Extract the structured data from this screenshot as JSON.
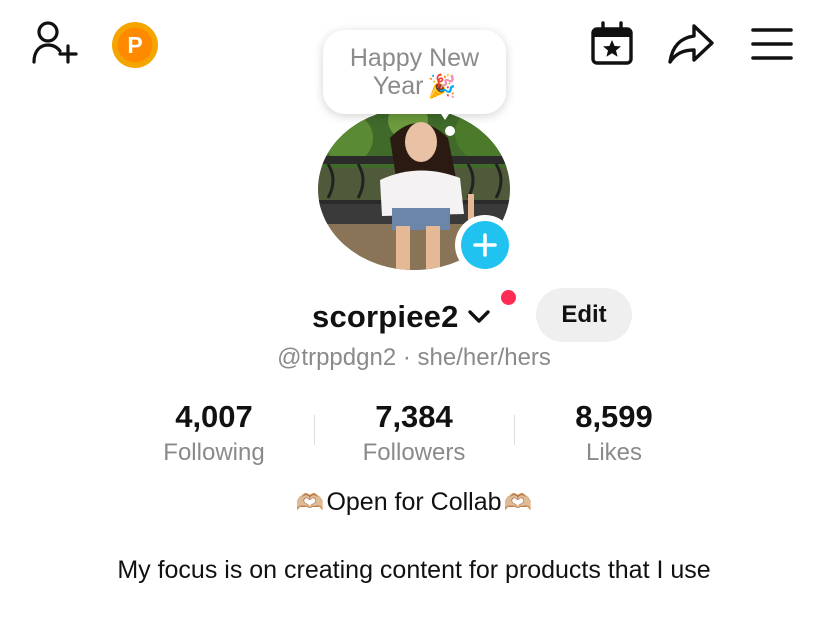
{
  "header": {
    "icons": [
      "add-friend-icon",
      "coin-icon",
      "calendar-star-icon",
      "share-icon",
      "menu-icon"
    ],
    "coin_letter": "P"
  },
  "bubble": {
    "line1": "Happy New",
    "line2": "Year",
    "emoji": "🎉"
  },
  "profile": {
    "username": "scorpiee2",
    "handle": "@trppdgn2",
    "separator": "·",
    "pronouns": "she/her/hers",
    "edit_label": "Edit"
  },
  "stats": [
    {
      "value": "4,007",
      "label": "Following"
    },
    {
      "value": "7,384",
      "label": "Followers"
    },
    {
      "value": "8,599",
      "label": "Likes"
    }
  ],
  "bio": {
    "line1_emoji_left": "🫶🏼",
    "line1_text": "Open for Collab",
    "line1_emoji_right": "🫶🏼",
    "line2": "My focus is on creating content for products that I use"
  },
  "colors": {
    "accent_cyan": "#20c3f0",
    "notification_red": "#fe2c55",
    "coin_orange": "#f5a500",
    "muted_text": "#8a8a8a"
  }
}
